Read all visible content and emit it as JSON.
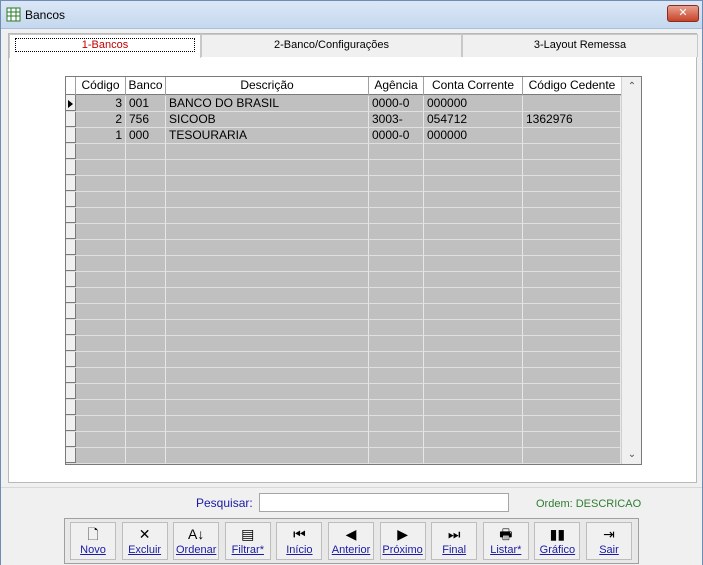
{
  "window": {
    "title": "Bancos",
    "close_label": "✕"
  },
  "tabs": [
    {
      "label": "1-Bancos"
    },
    {
      "label": "2-Banco/Configurações"
    },
    {
      "label": "3-Layout Remessa"
    }
  ],
  "grid": {
    "columns": [
      "Código",
      "Banco",
      "Descrição",
      "Agência",
      "Conta Corrente",
      "Código Cedente"
    ],
    "rows": [
      [
        "3",
        "001",
        "BANCO DO BRASIL",
        "0000-0",
        "000000",
        ""
      ],
      [
        "2",
        "756",
        "SICOOB",
        "3003-",
        "054712",
        "1362976"
      ],
      [
        "1",
        "000",
        "TESOURARIA",
        "0000-0",
        "000000",
        ""
      ]
    ]
  },
  "search": {
    "label": "Pesquisar:",
    "value": ""
  },
  "order": {
    "label": "Ordem: DESCRICAO"
  },
  "toolbar": {
    "buttons": [
      {
        "label": "Novo",
        "icon": "new-document-icon",
        "glyph": "🗋"
      },
      {
        "label": "Excluir",
        "icon": "delete-icon",
        "glyph": "✕"
      },
      {
        "label": "Ordenar",
        "icon": "sort-az-icon",
        "glyph": "A↓"
      },
      {
        "label": "Filtrar*",
        "icon": "filter-icon",
        "glyph": "▤"
      },
      {
        "label": "Início",
        "icon": "first-record-icon",
        "glyph": "⏮"
      },
      {
        "label": "Anterior",
        "icon": "previous-record-icon",
        "glyph": "◀"
      },
      {
        "label": "Próximo",
        "icon": "next-record-icon",
        "glyph": "▶"
      },
      {
        "label": "Final",
        "icon": "last-record-icon",
        "glyph": "⏭"
      },
      {
        "label": "Listar*",
        "icon": "printer-icon",
        "glyph": "🖶"
      },
      {
        "label": "Gráfico",
        "icon": "chart-icon",
        "glyph": "▮▮"
      },
      {
        "label": "Sair",
        "icon": "exit-door-icon",
        "glyph": "⇥"
      }
    ]
  },
  "colors": {
    "accent_tab": "#c00000",
    "label_blue": "#1a1aa6",
    "order_green": "#2e7d32",
    "grid_bg": "#c0c0c0"
  }
}
